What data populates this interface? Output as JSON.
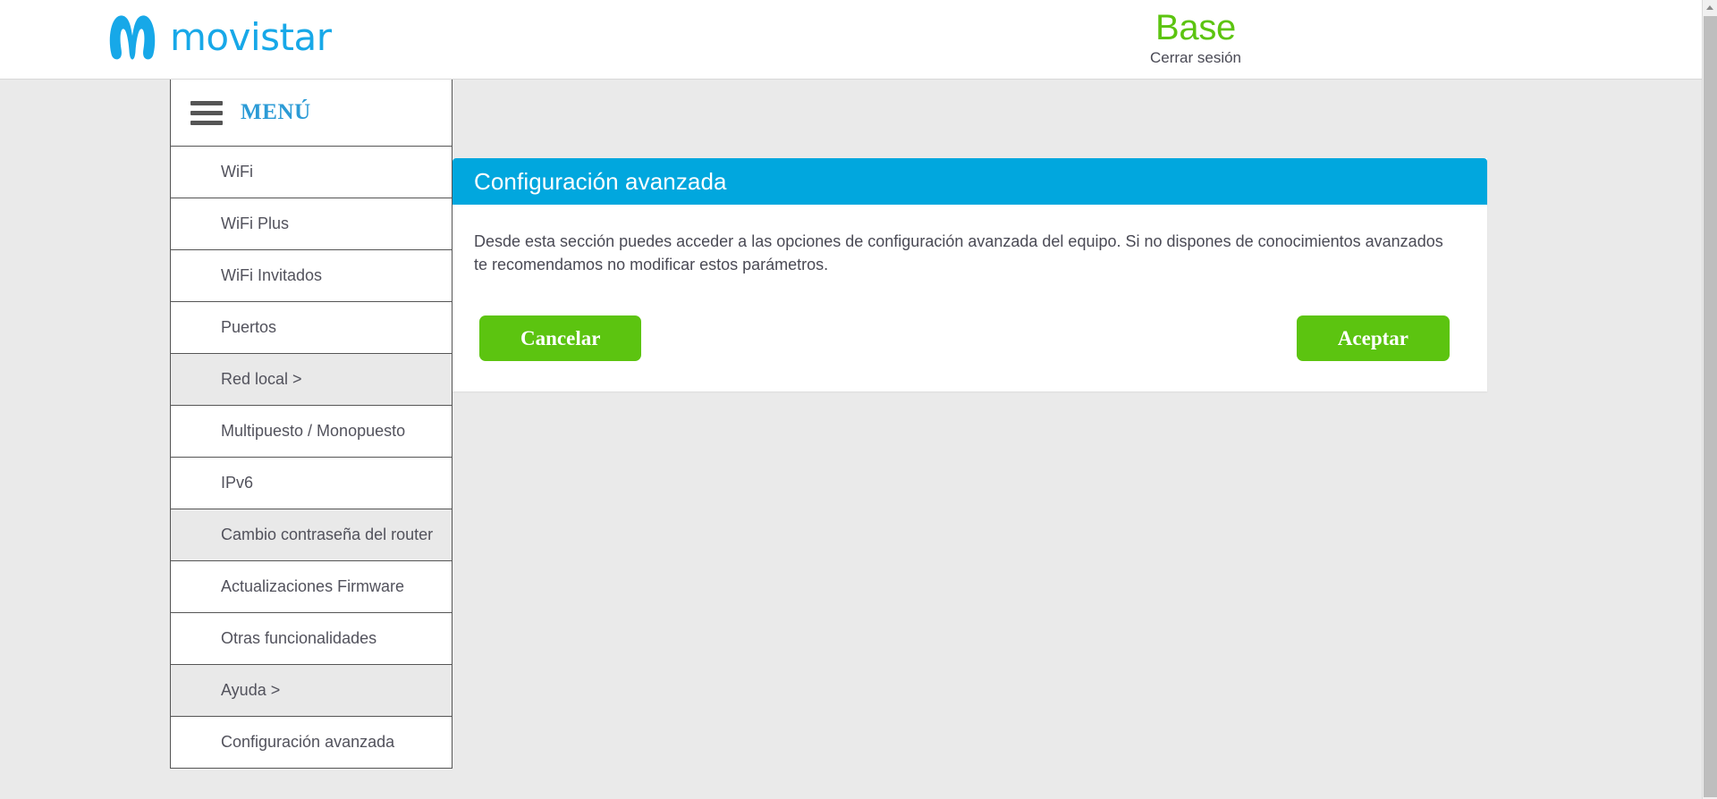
{
  "header": {
    "brand_name": "movistar",
    "logo_icon": "movistar-m-logo",
    "account_plan": "Base",
    "logout_label": "Cerrar sesión"
  },
  "menu": {
    "title": "MENÚ",
    "toggle_icon": "hamburger-icon",
    "items": [
      {
        "label": "WiFi",
        "highlighted": false
      },
      {
        "label": "WiFi Plus",
        "highlighted": false
      },
      {
        "label": "WiFi Invitados",
        "highlighted": false
      },
      {
        "label": "Puertos",
        "highlighted": false
      },
      {
        "label": "Red local >",
        "highlighted": true
      },
      {
        "label": "Multipuesto / Monopuesto",
        "highlighted": false
      },
      {
        "label": "IPv6",
        "highlighted": false
      },
      {
        "label": "Cambio contraseña del router",
        "highlighted": true
      },
      {
        "label": "Actualizaciones Firmware",
        "highlighted": false
      },
      {
        "label": "Otras funcionalidades",
        "highlighted": false
      },
      {
        "label": "Ayuda >",
        "highlighted": true
      },
      {
        "label": "Configuración avanzada",
        "highlighted": false
      }
    ]
  },
  "card": {
    "title": "Configuración avanzada",
    "description": "Desde esta sección puedes acceder a las opciones de configuración avanzada del equipo. Si no dispones de conocimientos avanzados te recomendamos no modificar estos parámetros.",
    "cancel_label": "Cancelar",
    "accept_label": "Aceptar"
  },
  "colors": {
    "brand_blue": "#17A8E8",
    "title_bar_blue": "#01A7DE",
    "accent_green": "#5CC410",
    "page_grey": "#EAEAEA",
    "menu_border": "#555555",
    "text_grey": "#52525C"
  },
  "scrollbar": {
    "up_arrow_icon": "triangle-up-icon"
  }
}
